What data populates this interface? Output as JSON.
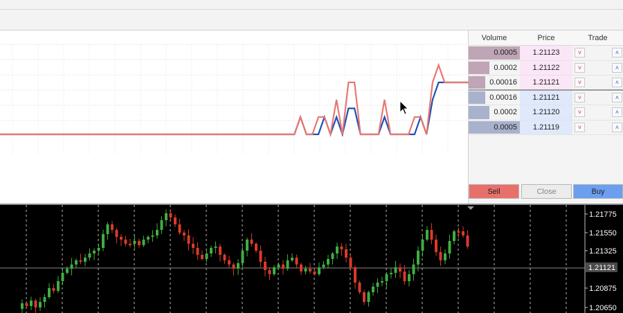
{
  "depth_of_market": {
    "columns": {
      "volume": "Volume",
      "price": "Price",
      "trade": "Trade"
    },
    "rows": [
      {
        "side": "ask",
        "volume": "0.0005",
        "price": "1.21123",
        "volume_fraction": 1.0
      },
      {
        "side": "ask",
        "volume": "0.0002",
        "price": "1.21122",
        "volume_fraction": 0.4
      },
      {
        "side": "ask",
        "volume": "0.00016",
        "price": "1.21121",
        "volume_fraction": 0.32
      },
      {
        "side": "bid",
        "volume": "0.00016",
        "price": "1.21121",
        "volume_fraction": 0.32
      },
      {
        "side": "bid",
        "volume": "0.0002",
        "price": "1.21120",
        "volume_fraction": 0.4
      },
      {
        "side": "bid",
        "volume": "0.0005",
        "price": "1.21119",
        "volume_fraction": 1.0
      }
    ],
    "buttons": {
      "sell": "Sell",
      "close": "Close",
      "buy": "Buy"
    },
    "sell_icon": "chevron-down-icon",
    "buy_icon": "chevron-up-icon"
  },
  "colors": {
    "ask_bg": "#fbe6f7",
    "bid_bg": "#dfe9fb",
    "ask_volume_bar": "#bfa5b6",
    "bid_volume_bar": "#a9b2cc",
    "ask_line": "#e8776e",
    "bid_line": "#1f4fb5",
    "bull_candle": "#3fae3f",
    "bear_candle": "#d93a2b",
    "chart_bg": "#000000"
  },
  "tick_chart": {
    "points_ask": [
      0,
      0,
      0,
      0,
      0,
      0,
      0,
      0,
      0,
      0,
      0,
      0,
      0,
      0,
      0,
      0,
      0,
      0,
      0,
      0,
      0,
      0,
      0,
      0,
      0,
      0,
      0,
      0,
      0,
      0,
      0,
      0,
      0,
      0,
      0,
      0,
      0,
      0,
      0,
      0,
      0,
      0,
      0,
      0,
      0,
      0,
      0,
      0,
      0,
      0,
      1,
      0,
      0,
      1,
      1,
      0,
      2,
      0,
      3,
      3,
      0,
      0,
      0,
      0,
      2,
      0,
      0,
      0,
      0,
      1,
      1,
      0,
      3,
      4,
      3,
      3,
      3,
      3,
      3
    ],
    "points_bid": [
      0,
      0,
      0,
      0,
      0,
      0,
      0,
      0,
      0,
      0,
      0,
      0,
      0,
      0,
      0,
      0,
      0,
      0,
      0,
      0,
      0,
      0,
      0,
      0,
      0,
      0,
      0,
      0,
      0,
      0,
      0,
      0,
      0,
      0,
      0,
      0,
      0,
      0,
      0,
      0,
      0,
      0,
      0,
      0,
      0,
      0,
      0,
      0,
      0,
      0,
      1,
      0,
      0,
      0,
      1,
      0,
      1,
      0,
      1.5,
      1.5,
      0,
      0,
      0,
      0,
      1,
      0,
      0,
      0,
      0,
      0,
      1,
      0,
      2,
      3,
      3,
      3,
      3,
      3,
      3
    ]
  },
  "price_chart": {
    "axis_labels": [
      "1.21775",
      "1.21550",
      "1.21325",
      "1.21121",
      "1.20875",
      "1.20650"
    ],
    "current_price": "1.21121"
  }
}
